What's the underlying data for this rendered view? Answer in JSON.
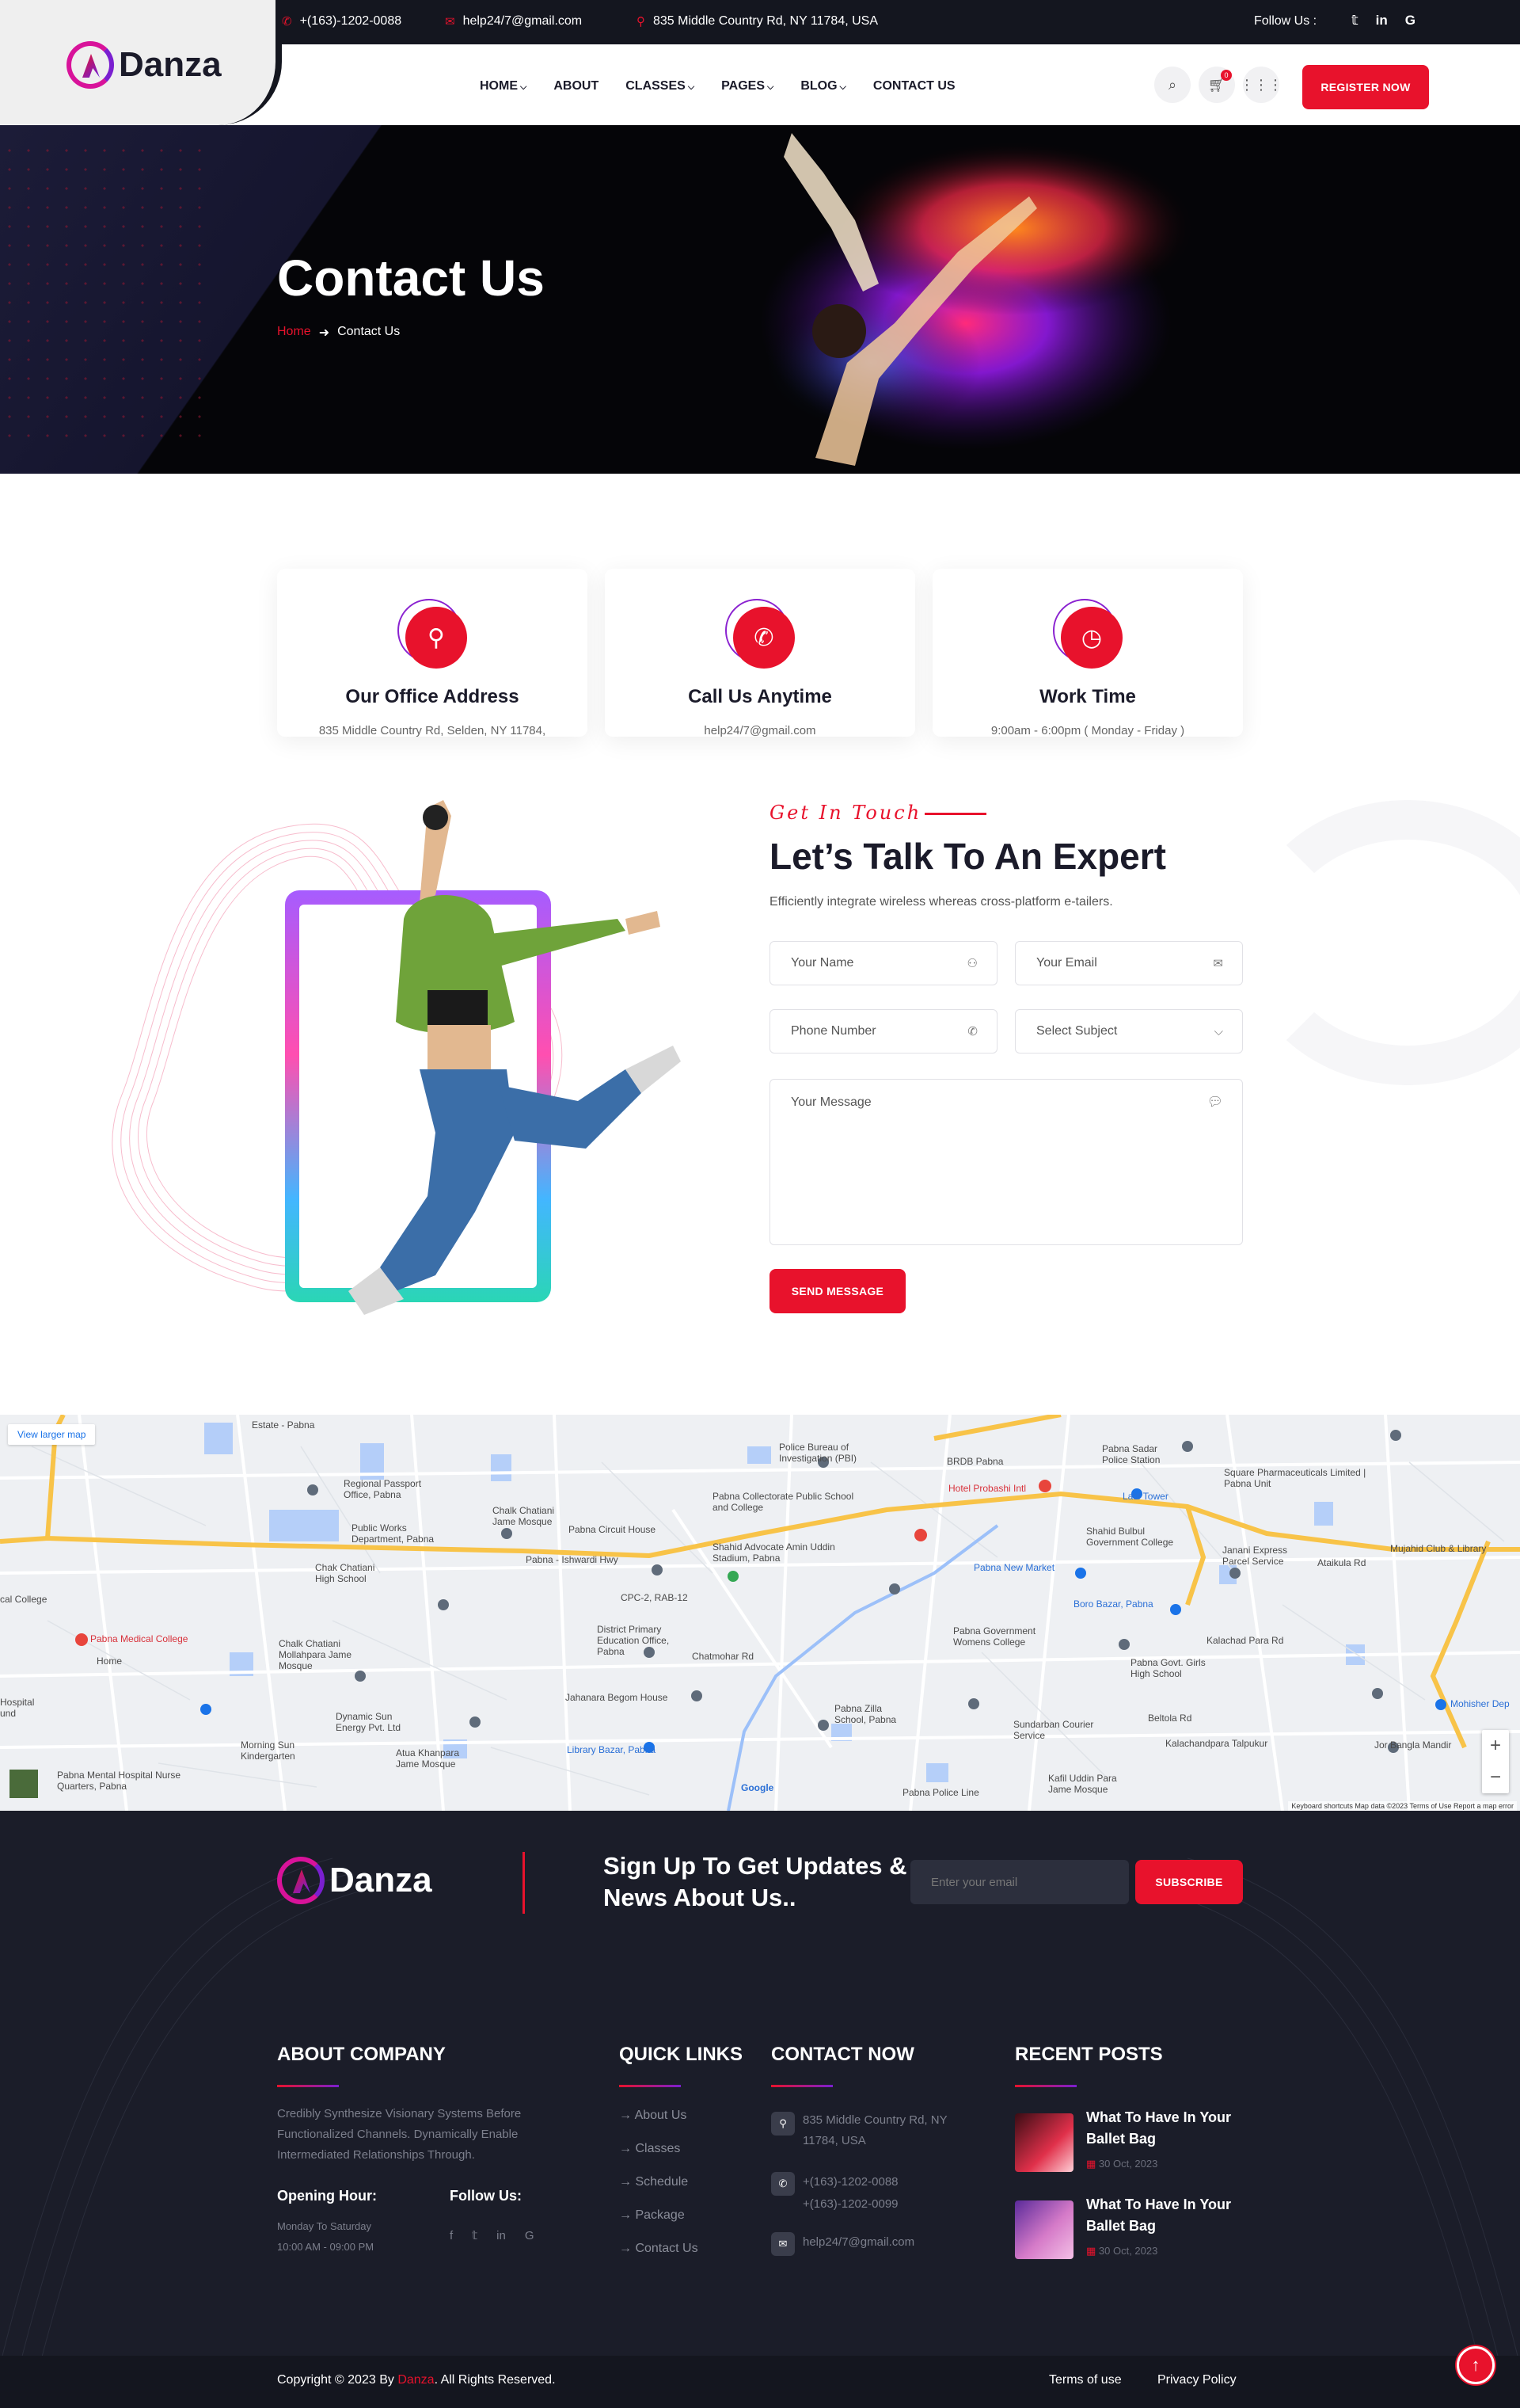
{
  "topbar": {
    "phone": "+(163)-1202-0088",
    "email": "help24/7@gmail.com",
    "address": "835 Middle Country Rd, NY 11784, USA",
    "follow_label": "Follow Us :",
    "social": [
      "twitter-icon",
      "linkedin-icon",
      "google-icon"
    ]
  },
  "brand": {
    "name": "Danza"
  },
  "nav": {
    "items": [
      {
        "label": "HOME",
        "dropdown": true
      },
      {
        "label": "ABOUT",
        "dropdown": false
      },
      {
        "label": "CLASSES",
        "dropdown": true
      },
      {
        "label": "PAGES",
        "dropdown": true
      },
      {
        "label": "BLOG",
        "dropdown": true
      },
      {
        "label": "CONTACT US",
        "dropdown": false
      }
    ],
    "cart_count": "0",
    "cta": "REGISTER NOW"
  },
  "hero": {
    "title": "Contact Us",
    "breadcrumb_home": "Home",
    "breadcrumb_current": "Contact Us"
  },
  "cards": [
    {
      "title": "Our Office Address",
      "text": "835 Middle Country Rd, Selden, NY 11784,",
      "icon": "location-icon"
    },
    {
      "title": "Call Us Anytime",
      "text": "help24/7@gmail.com",
      "icon": "phone-icon"
    },
    {
      "title": "Work Time",
      "text": "9:00am - 6:00pm ( Monday - Friday )",
      "icon": "clock-icon"
    }
  ],
  "contact": {
    "eyebrow": "Get In Touch",
    "title": "Let’s Talk To An Expert",
    "subtitle": "Efficiently integrate wireless whereas cross-platform e-tailers.",
    "name_placeholder": "Your Name",
    "email_placeholder": "Your Email",
    "phone_placeholder": "Phone Number",
    "subject_placeholder": "Select Subject",
    "message_placeholder": "Your Message",
    "submit": "SEND MESSAGE"
  },
  "map": {
    "view_larger": "View larger map",
    "footer_text": "Keyboard shortcuts   Map data ©2023   Terms of Use   Report a map error",
    "labels": [
      {
        "t": "Estate - Pabna",
        "c": ""
      },
      {
        "t": "Police Bureau of Investigation (PBI)",
        "c": ""
      },
      {
        "t": "BRDB Pabna",
        "c": ""
      },
      {
        "t": "Pabna Sadar Police Station",
        "c": ""
      },
      {
        "t": "Regional Passport Office, Pabna",
        "c": ""
      },
      {
        "t": "Pabna Collectorate Public School and College",
        "c": ""
      },
      {
        "t": "Hotel Probashi Intl",
        "c": "red"
      },
      {
        "t": "Latif Tower",
        "c": "blue"
      },
      {
        "t": "Square Pharmaceuticals Limited | Pabna Unit",
        "c": ""
      },
      {
        "t": "Public Works Department, Pabna",
        "c": ""
      },
      {
        "t": "Chalk Chatiani Jame Mosque",
        "c": ""
      },
      {
        "t": "Pabna Circuit House",
        "c": ""
      },
      {
        "t": "Shahid Bulbul Government College",
        "c": ""
      },
      {
        "t": "Janani Express Parcel Service",
        "c": ""
      },
      {
        "t": "Mujahid Club & Library",
        "c": ""
      },
      {
        "t": "Chak Chatiani High School",
        "c": ""
      },
      {
        "t": "Pabna - Ishwardi Hwy",
        "c": ""
      },
      {
        "t": "Shahid Advocate Amin Uddin Stadium, Pabna",
        "c": ""
      },
      {
        "t": "Pabna New Market",
        "c": "blue"
      },
      {
        "t": "Ataikula Rd",
        "c": ""
      },
      {
        "t": "Boro Bazar, Pabna",
        "c": "blue"
      },
      {
        "t": "cal College",
        "c": ""
      },
      {
        "t": "Pabna Medical College",
        "c": "red"
      },
      {
        "t": "District Primary Education Office, Pabna",
        "c": ""
      },
      {
        "t": "Pabna Government Womens College",
        "c": ""
      },
      {
        "t": "Chalk Chatiani Mollahpara Jame Mosque",
        "c": ""
      },
      {
        "t": "Home",
        "c": ""
      },
      {
        "t": "Pabna Govt. Girls High School",
        "c": ""
      },
      {
        "t": "Jahanara Begom House",
        "c": ""
      },
      {
        "t": "Pabna Zilla School, Pabna",
        "c": ""
      },
      {
        "t": "Dynamic Sun Energy Pvt. Ltd",
        "c": ""
      },
      {
        "t": "Sundarban Courier Service",
        "c": ""
      },
      {
        "t": "Kalachandpara Talpukur",
        "c": ""
      },
      {
        "t": "Jor Bangla Mandir",
        "c": ""
      },
      {
        "t": "Mohisher Dep",
        "c": "blue"
      },
      {
        "t": "Hospital und",
        "c": ""
      },
      {
        "t": "Morning Sun Kindergarten",
        "c": ""
      },
      {
        "t": "Library Bazar, Pabna",
        "c": "blue"
      },
      {
        "t": "Atua Khanpara Jame Mosque",
        "c": ""
      },
      {
        "t": "Kafil Uddin Para Jame Mosque",
        "c": ""
      },
      {
        "t": "Pabna Mental Hospital Nurse Quarters, Pabna",
        "c": ""
      },
      {
        "t": "Pabna Police Line",
        "c": ""
      },
      {
        "t": "CPC-2, RAB-12",
        "c": ""
      },
      {
        "t": "Chatmohar Rd",
        "c": ""
      },
      {
        "t": "Kalachad Para Rd",
        "c": ""
      },
      {
        "t": "Beltola Rd",
        "c": ""
      },
      {
        "t": "Google",
        "c": ""
      }
    ]
  },
  "footer": {
    "newsletter_title": "Sign Up To Get Updates & News About Us..",
    "newsletter_placeholder": "Enter your email",
    "newsletter_button": "SUBSCRIBE",
    "about_heading": "ABOUT COMPANY",
    "about_text": "Credibly Synthesize Visionary Systems Before Functionalized Channels. Dynamically Enable Intermediated Relationships Through.",
    "opening_label": "Opening Hour:",
    "opening_days": "Monday To Saturday",
    "opening_time": "10:00 AM - 09:00 PM",
    "follow_label": "Follow Us:",
    "follow_icons": [
      "facebook-icon",
      "twitter-icon",
      "linkedin-icon",
      "google-icon"
    ],
    "quick_heading": "QUICK LINKS",
    "quick_links": [
      "About Us",
      "Classes",
      "Schedule",
      "Package",
      "Contact Us"
    ],
    "contact_heading": "CONTACT NOW",
    "contact_address": "835 Middle Country Rd, NY 11784, USA",
    "contact_phone1": "+(163)-1202-0088",
    "contact_phone2": "+(163)-1202-0099",
    "contact_email": "help24/7@gmail.com",
    "posts_heading": "RECENT POSTS",
    "posts": [
      {
        "title": "What To Have In Your Ballet Bag",
        "date": "30 Oct, 2023"
      },
      {
        "title": "What To Have In Your Ballet Bag",
        "date": "30 Oct, 2023"
      }
    ],
    "copyright_pre": "Copyright © 2023 By ",
    "copyright_brand": "Danza",
    "copyright_post": ". All Rights Reserved.",
    "terms": "Terms of use",
    "privacy": "Privacy Policy"
  }
}
